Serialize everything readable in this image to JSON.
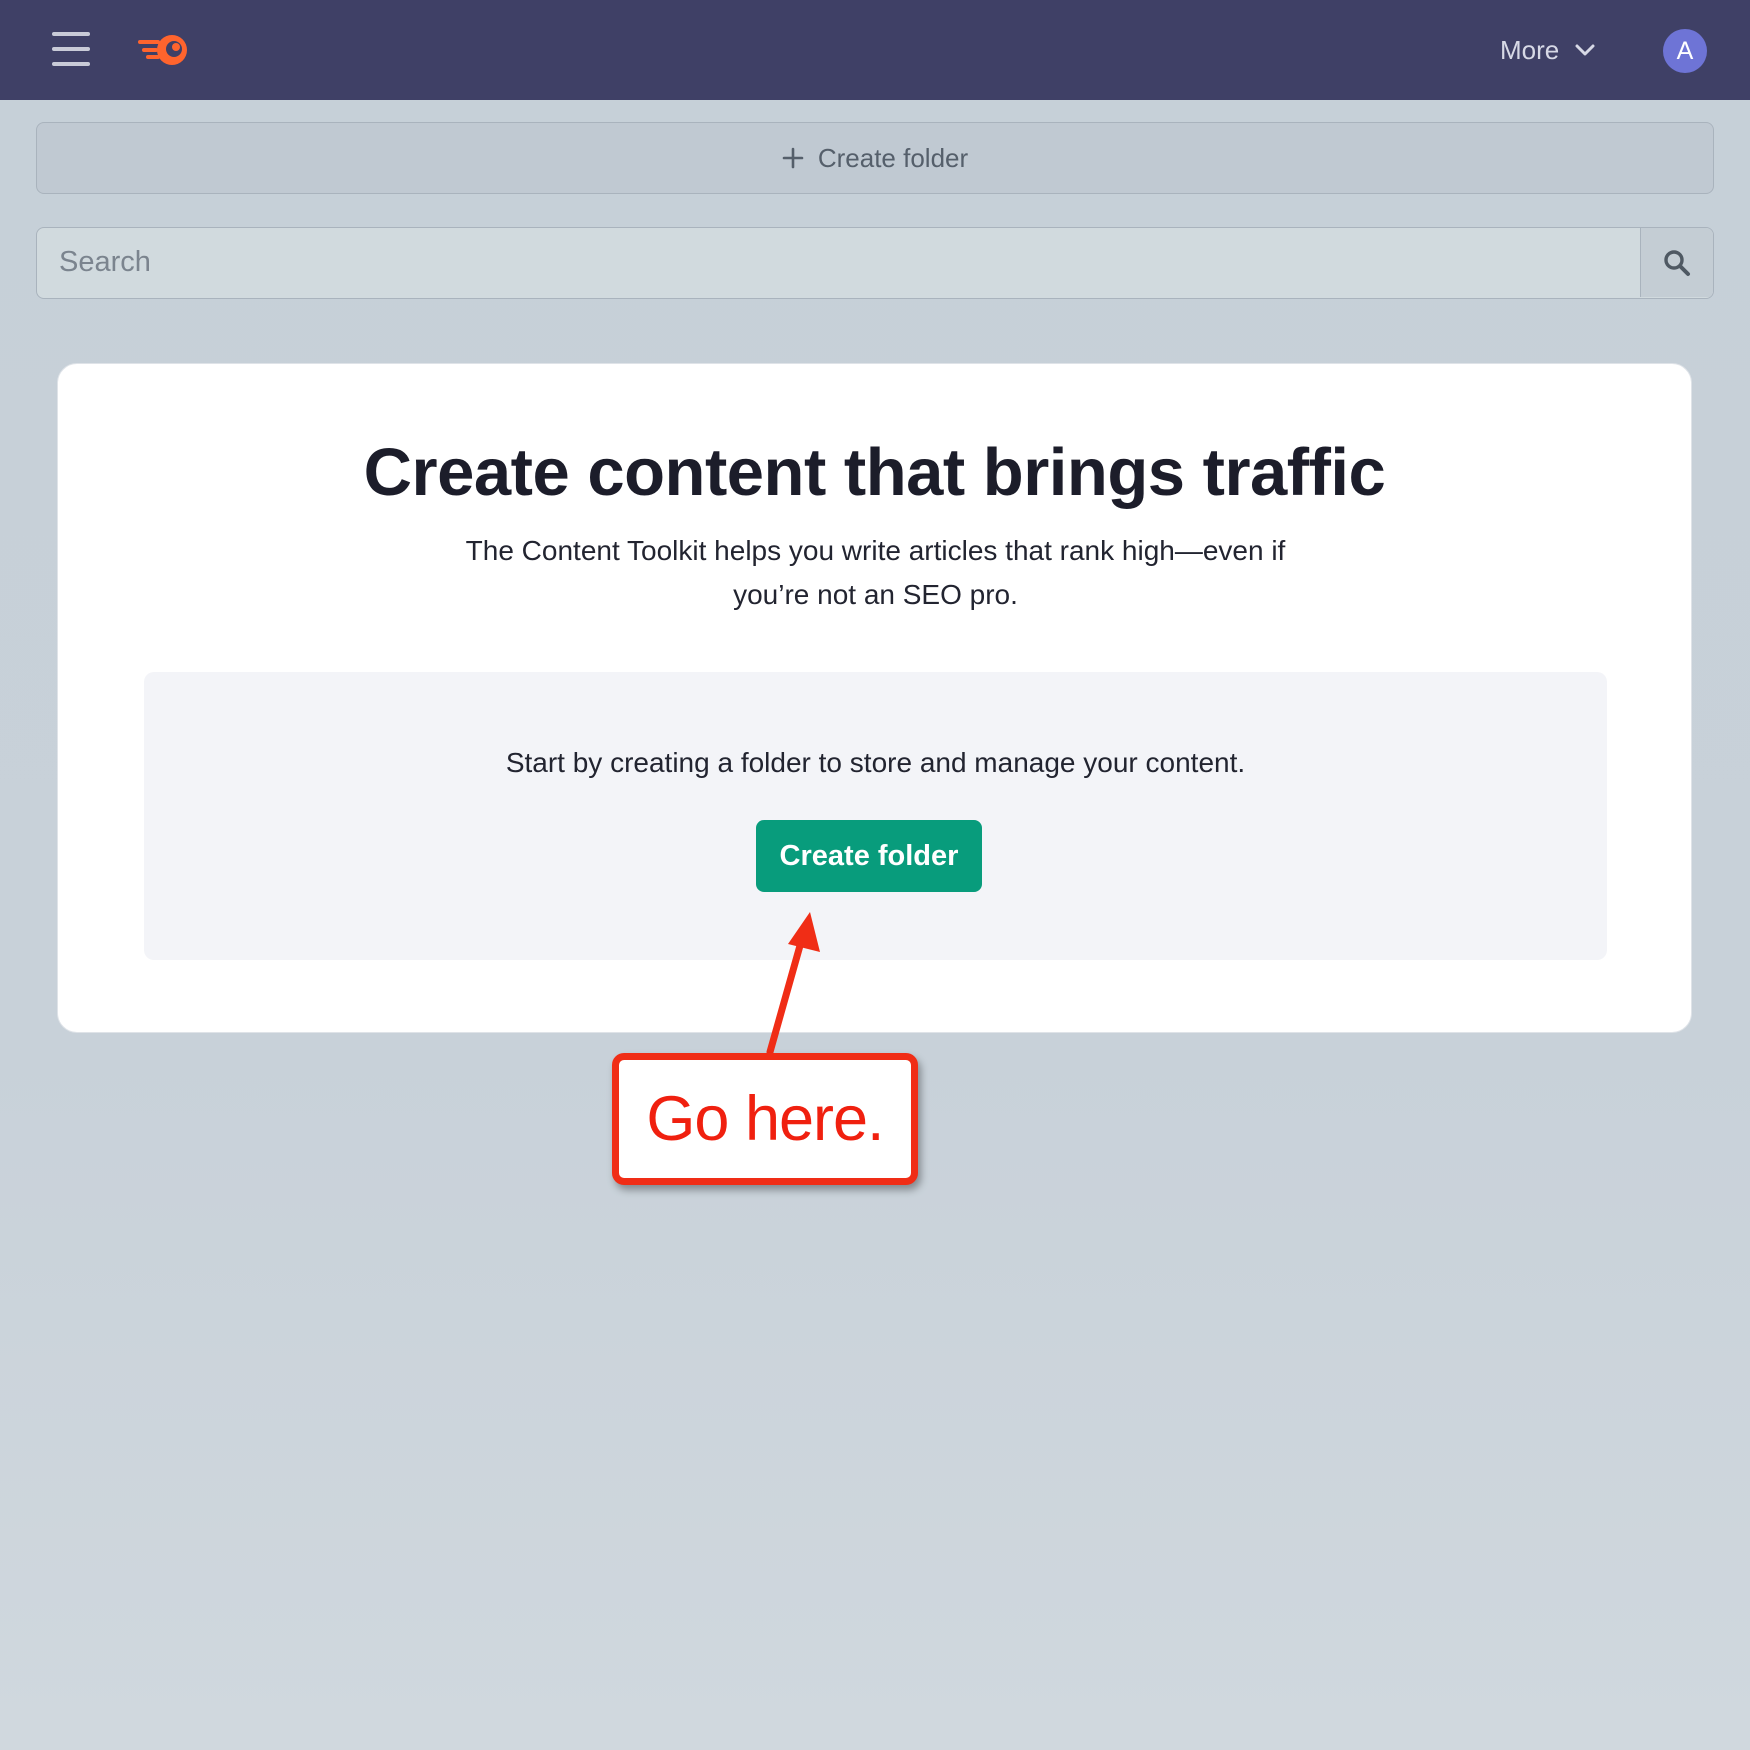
{
  "header": {
    "menu_icon": "hamburger-menu-icon",
    "logo_icon": "semrush-logo-icon",
    "more_label": "More",
    "more_icon": "chevron-down-icon",
    "avatar_initial": "A",
    "colors": {
      "background": "#3f4066",
      "logo": "#ff642d",
      "avatar": "#6e74d6"
    }
  },
  "toolbar": {
    "create_folder_label": "Create folder",
    "create_folder_icon": "plus-icon"
  },
  "search": {
    "placeholder": "Search",
    "value": "",
    "icon": "search-icon"
  },
  "empty_state": {
    "title": "Create content that brings traffic",
    "subtitle": "The Content Toolkit helps you write articles that rank high—even if you’re not an SEO pro.",
    "prompt": "Start by creating a folder to store and manage your content.",
    "cta_label": "Create folder",
    "cta_color": "#089c7c"
  },
  "annotation": {
    "callout_text": "Go here.",
    "color": "#f02d16"
  }
}
